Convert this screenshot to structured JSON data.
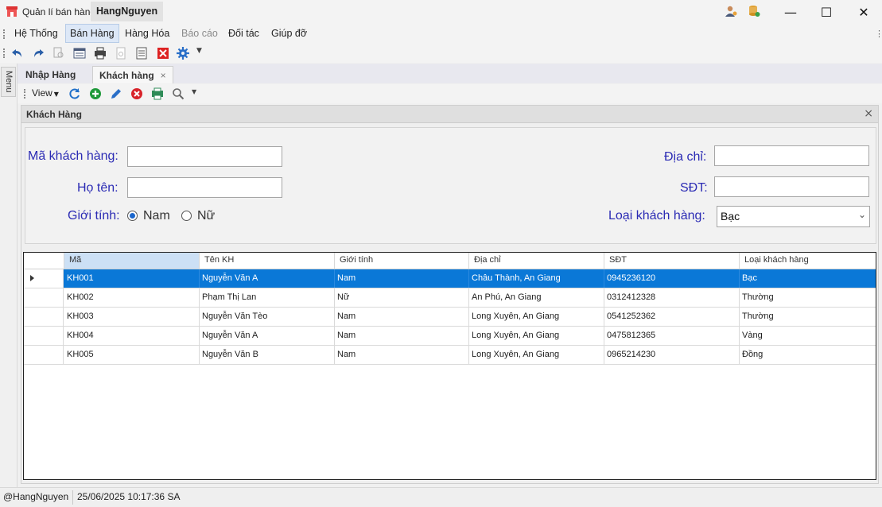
{
  "titlebar": {
    "app_title": "Quản lí bán hàng",
    "user": "HangNguyen"
  },
  "menu": {
    "items": [
      {
        "label": "Hệ Thống",
        "state": "normal"
      },
      {
        "label": "Bán Hàng",
        "state": "active"
      },
      {
        "label": "Hàng Hóa",
        "state": "normal"
      },
      {
        "label": "Báo cáo",
        "state": "disabled"
      },
      {
        "label": "Đối tác",
        "state": "normal"
      },
      {
        "label": "Giúp đỡ",
        "state": "normal"
      }
    ]
  },
  "side": {
    "tab_label": "Menu"
  },
  "doc_tabs": [
    {
      "label": "Nhập Hàng"
    },
    {
      "label": "Khách hàng",
      "close": "×"
    }
  ],
  "viewbar": {
    "view_label": "View"
  },
  "panel": {
    "title": "Khách Hàng",
    "close": "×"
  },
  "form": {
    "ma_label": "Mã khách hàng:",
    "ma_value": "",
    "hoten_label": "Họ tên:",
    "hoten_value": "",
    "gioitinh_label": "Giới tính:",
    "gender_male": "Nam",
    "gender_female": "Nữ",
    "diachi_label": "Địa chỉ:",
    "diachi_value": "",
    "sdt_label": "SĐT:",
    "sdt_value": "",
    "loai_label": "Loại khách hàng:",
    "loai_value": "Bạc"
  },
  "grid": {
    "columns": [
      "Mã",
      "Tên KH",
      "Giới tính",
      "Địa chỉ",
      "SĐT",
      "Loại khách hàng"
    ],
    "rows": [
      [
        "KH001",
        "Nguyễn Văn A",
        "Nam",
        "Châu Thành, An Giang",
        "0945236120",
        "Bạc"
      ],
      [
        "KH002",
        "Phạm Thị Lan",
        "Nữ",
        "An Phú, An Giang",
        "0312412328",
        "Thường"
      ],
      [
        "KH003",
        "Nguyễn Văn Tèo",
        "Nam",
        "Long Xuyên, An Giang",
        "0541252362",
        "Thường"
      ],
      [
        "KH004",
        "Nguyễn Văn A",
        "Nam",
        "Long Xuyên, An Giang",
        "0475812365",
        "Vàng"
      ],
      [
        "KH005",
        "Nguyễn Văn B",
        "Nam",
        "Long Xuyên, An Giang",
        "0965214230",
        "Đồng"
      ]
    ]
  },
  "status": {
    "user": "@HangNguyen",
    "datetime": "25/06/2025 10:17:36 SA"
  },
  "colors": {
    "accent": "#0a78d7",
    "label_blue": "#2b2bb4"
  }
}
